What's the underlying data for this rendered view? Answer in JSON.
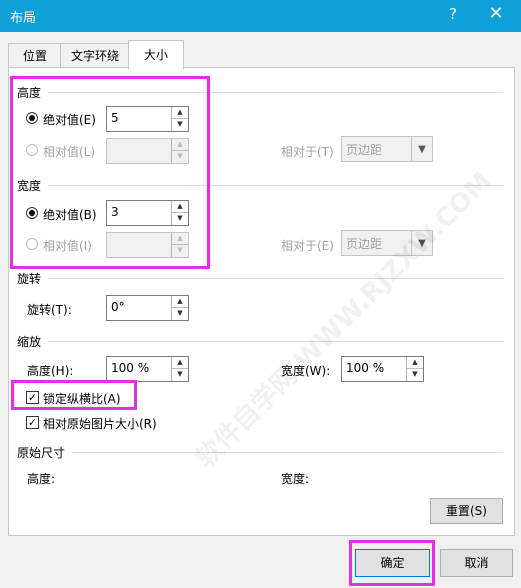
{
  "window": {
    "title": "布局",
    "help_label": "?",
    "close_label": "✕"
  },
  "tabs": [
    {
      "label": "位置"
    },
    {
      "label": "文字环绕"
    },
    {
      "label": "大小"
    }
  ],
  "height": {
    "section_label": "高度",
    "absolute_label": "绝对值(E)",
    "absolute_value": "5",
    "relative_label": "相对值(L)",
    "relative_to_label": "相对于(T)",
    "relative_to_value": "页边距"
  },
  "width": {
    "section_label": "宽度",
    "absolute_label": "绝对值(B)",
    "absolute_value": "3",
    "relative_label": "相对值(I)",
    "relative_to_label": "相对于(E)",
    "relative_to_value": "页边距"
  },
  "rotation": {
    "section_label": "旋转",
    "label": "旋转(T):",
    "value": "0°"
  },
  "scale": {
    "section_label": "缩放",
    "height_label": "高度(H):",
    "height_value": "100 %",
    "width_label": "宽度(W):",
    "width_value": "100 %",
    "lock_aspect_label": "锁定纵横比(A)",
    "relative_original_label": "相对原始图片大小(R)"
  },
  "original": {
    "section_label": "原始尺寸",
    "height_label": "高度:",
    "width_label": "宽度:"
  },
  "buttons": {
    "reset": "重置(S)",
    "ok": "确定",
    "cancel": "取消"
  },
  "watermark": "软件自学网 WWW.RJZXW.COM"
}
